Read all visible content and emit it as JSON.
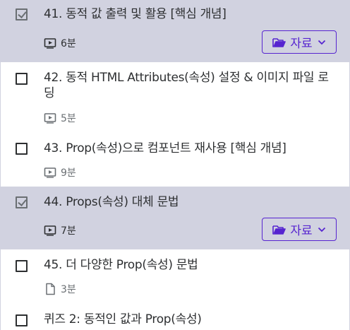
{
  "lectures": [
    {
      "title": "41. 동적 값 출력 및 활용 [핵심 개념]",
      "type": "video",
      "duration": "6분",
      "active": true,
      "checked": true,
      "resources_label": "자료"
    },
    {
      "title": "42. 동적 HTML Attributes(속성) 설정 & 이미지 파일 로딩",
      "type": "video",
      "duration": "5분",
      "active": false,
      "checked": false
    },
    {
      "title": "43. Prop(속성)으로 컴포넌트 재사용 [핵심 개념]",
      "type": "video",
      "duration": "9분",
      "active": false,
      "checked": false
    },
    {
      "title": "44. Props(속성) 대체 문법",
      "type": "video",
      "duration": "7분",
      "active": true,
      "checked": true,
      "resources_label": "자료"
    },
    {
      "title": "45. 더 다양한 Prop(속성) 문법",
      "type": "article",
      "duration": "3분",
      "active": false,
      "checked": false
    },
    {
      "title": "퀴즈 2: 동적인 값과 Prop(속성)",
      "type": "quiz",
      "active": false,
      "checked": false
    }
  ],
  "icons": {
    "video": "video-play-icon",
    "article": "file-icon",
    "folder": "folder-open-icon",
    "chevron": "chevron-down-icon"
  },
  "colors": {
    "active_bg": "#d1d2e0",
    "accent": "#5624d0",
    "text": "#2d2f31",
    "muted": "#6a6f73"
  }
}
